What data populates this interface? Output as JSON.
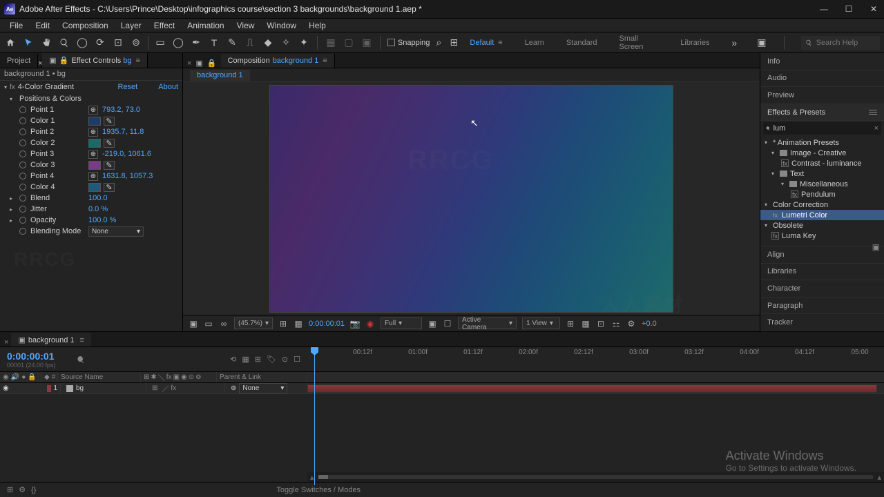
{
  "title": "Adobe After Effects - C:\\Users\\Prince\\Desktop\\infographics course\\section 3 backgrounds\\background 1.aep *",
  "menus": [
    "File",
    "Edit",
    "Composition",
    "Layer",
    "Effect",
    "Animation",
    "View",
    "Window",
    "Help"
  ],
  "snapping_label": "Snapping",
  "workspaces": {
    "items": [
      "Default",
      "Learn",
      "Standard",
      "Small Screen",
      "Libraries"
    ],
    "active": "Default"
  },
  "search_placeholder": "Search Help",
  "left_panel": {
    "tabs": [
      "Project",
      "Effect Controls"
    ],
    "effect_tab_suffix": "bg",
    "breadcrumb": "background 1 • bg",
    "effect": {
      "name": "4-Color Gradient",
      "reset": "Reset",
      "about": "About",
      "group": "Positions & Colors",
      "rows": [
        {
          "label": "Point 1",
          "value": "793.2, 73.0",
          "type": "point"
        },
        {
          "label": "Color 1",
          "color": "#1e3c6a",
          "type": "color"
        },
        {
          "label": "Point 2",
          "value": "1935.7, 11.8",
          "type": "point"
        },
        {
          "label": "Color 2",
          "color": "#1a6a6a",
          "type": "color"
        },
        {
          "label": "Point 3",
          "value": "-219.0, 1061.6",
          "type": "point"
        },
        {
          "label": "Color 3",
          "color": "#7a3a8a",
          "type": "color"
        },
        {
          "label": "Point 4",
          "value": "1631.8, 1057.3",
          "type": "point"
        },
        {
          "label": "Color 4",
          "color": "#1e5a7a",
          "type": "color"
        }
      ],
      "blend": {
        "label": "Blend",
        "value": "100.0"
      },
      "jitter": {
        "label": "Jitter",
        "value": "0.0 %"
      },
      "opacity": {
        "label": "Opacity",
        "value": "100.0 %"
      },
      "blending_mode": {
        "label": "Blending Mode",
        "value": "None"
      }
    }
  },
  "center": {
    "compTabLabel": "Composition",
    "compName": "background 1",
    "subtabs": [
      "background 1"
    ],
    "viewer_bar": {
      "zoom": "(45.7%)",
      "time": "0:00:00:01",
      "resolution": "Full",
      "camera": "Active Camera",
      "views": "1 View",
      "exposure": "+0.0"
    }
  },
  "right": {
    "panels": [
      "Info",
      "Audio",
      "Preview"
    ],
    "ep_head": "Effects & Presets",
    "ep_search": "lum",
    "tree": {
      "animPresets": "* Animation Presets",
      "imageCreative": "Image - Creative",
      "contrastLum": "Contrast - luminance",
      "text": "Text",
      "misc": "Miscellaneous",
      "pendulum": "Pendulum",
      "colorCorrection": "Color Correction",
      "lumetri": "Lumetri Color",
      "obsolete": "Obsolete",
      "lumaKey": "Luma Key"
    },
    "lower": [
      "Align",
      "Libraries",
      "Character",
      "Paragraph",
      "Tracker"
    ]
  },
  "timeline": {
    "tab": "background 1",
    "timecode": "0:00:00:01",
    "timecode_sub": "00001 (24.00 fps)",
    "header": {
      "source": "Source Name",
      "parent": "Parent & Link"
    },
    "layer": {
      "num": "1",
      "name": "bg",
      "parent": "None"
    },
    "ticks": [
      "",
      "01:00f",
      "02:12f",
      "01:00f",
      "01:12f",
      "02:00f",
      "02:12f",
      "03:00f",
      "03:12f",
      "04:00f",
      "04:12f",
      "05:00"
    ],
    "ticks_real": [
      "00:12f",
      "01:00f",
      "01:12f",
      "02:00f",
      "02:12f",
      "03:00f",
      "03:12f",
      "04:00f",
      "04:12f",
      "05:00"
    ],
    "footer": "Toggle Switches / Modes"
  },
  "activate": {
    "h": "Activate Windows",
    "s": "Go to Settings to activate Windows."
  }
}
